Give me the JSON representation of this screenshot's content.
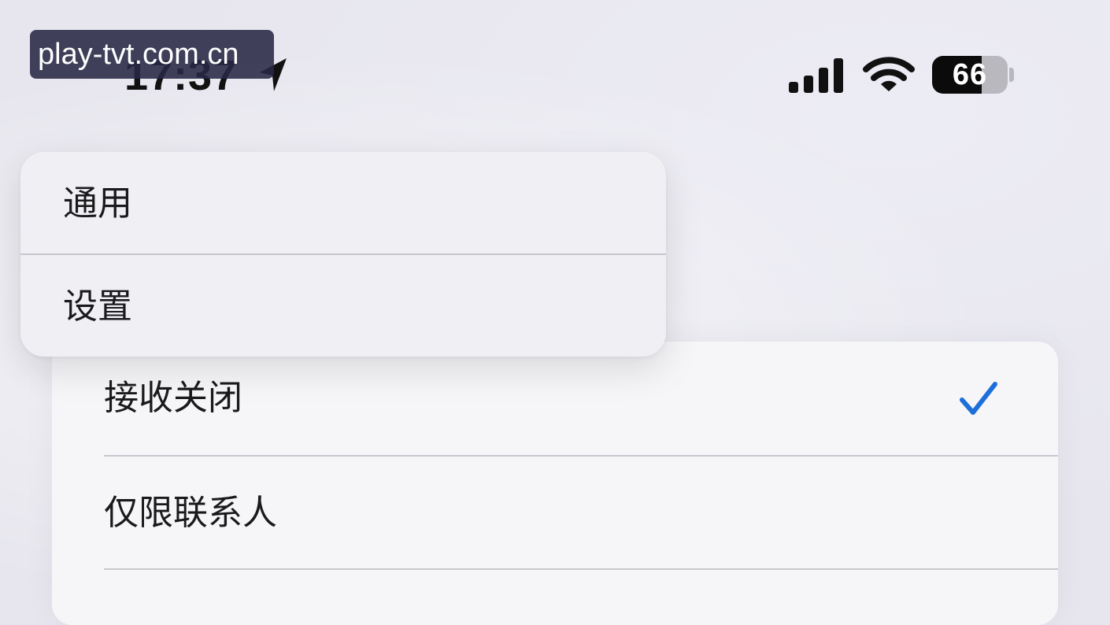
{
  "status_bar": {
    "time": "17:37",
    "battery_level": "66",
    "battery_fraction": 0.66,
    "icons": [
      "location-arrow-icon",
      "cellular-signal-icon",
      "wifi-icon",
      "battery-icon"
    ]
  },
  "watermark": {
    "text": "play-tvt.com.cn"
  },
  "menu": {
    "items": [
      {
        "label": "通用"
      },
      {
        "label": "设置"
      }
    ]
  },
  "list": {
    "items": [
      {
        "label": "接收关闭",
        "selected": true
      },
      {
        "label": "仅限联系人",
        "selected": false
      }
    ]
  },
  "colors": {
    "accent": "#1e6fd9",
    "background": "#e7e6ee",
    "card": "#f6f6f9",
    "menu": "#f0eff3"
  }
}
